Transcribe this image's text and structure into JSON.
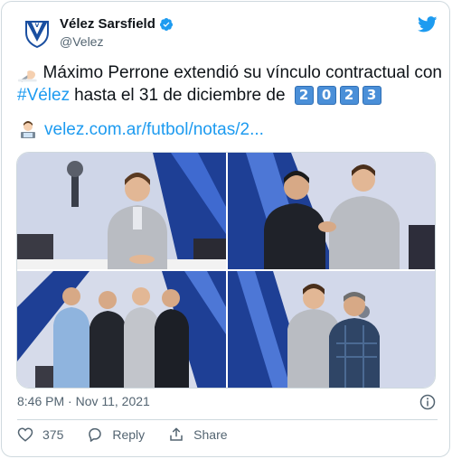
{
  "account": {
    "display_name": "Vélez Sarsfield",
    "handle": "@Velez",
    "verified": true,
    "brand_color": "#1d9bf0"
  },
  "tweet": {
    "text_part1": "Máximo Perrone extendió su vínculo contractual con",
    "hashtag": "#Vélez",
    "text_part2": "hasta el 31 de diciembre de",
    "year_digits": [
      "2",
      "0",
      "2",
      "3"
    ],
    "link": "velez.com.ar/futbol/notas/2...",
    "emoji_lead": "writing-hand",
    "emoji_link": "technologist"
  },
  "media": {
    "photo_count": 4
  },
  "meta": {
    "timestamp": "8:46 PM · Nov 11, 2021"
  },
  "actions": {
    "like_count": "375",
    "reply_label": "Reply",
    "share_label": "Share"
  }
}
